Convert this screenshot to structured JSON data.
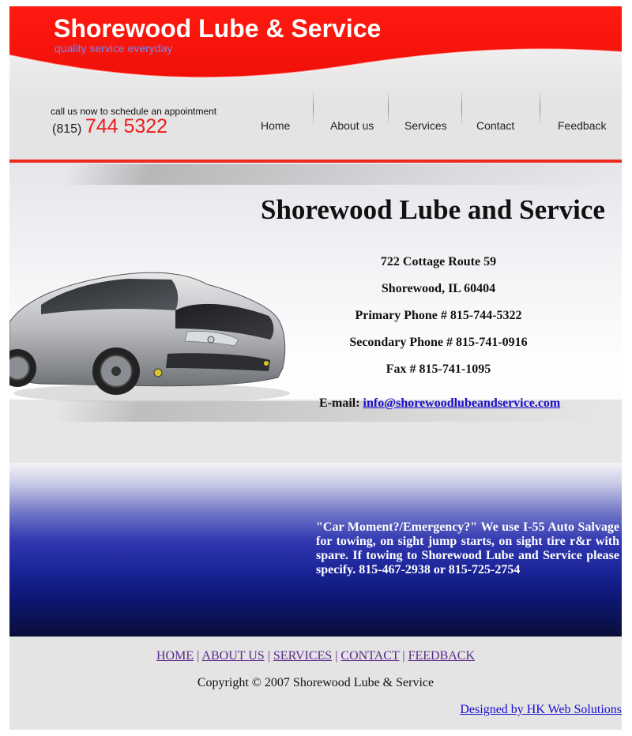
{
  "header": {
    "site_title": "Shorewood Lube & Service",
    "tagline": "quality service everyday",
    "call_label": "call us now to schedule an appointment",
    "phone_area": "(815)",
    "phone_number": "744 5322"
  },
  "nav": {
    "items": [
      "Home",
      "About us",
      "Services",
      "Contact",
      "Feedback"
    ]
  },
  "main": {
    "business_name": "Shorewood Lube and Service",
    "address_line1": "722 Cottage Route 59",
    "address_line2": "Shorewood, IL 60404",
    "primary_phone": "Primary Phone # 815-744-5322",
    "secondary_phone": "Secondary Phone # 815-741-0916",
    "fax": "Fax # 815-741-1095",
    "email_label": "E-mail:",
    "email": "info@shorewoodlubeandservice.com",
    "emergency_text": "\"Car Moment?/Emergency?\" We use I-55 Auto Salvage for towing, on sight jump starts, on sight tire r&r with spare. If towing to Shorewood Lube and Service please specify. 815-467-2938 or 815-725-2754"
  },
  "footer": {
    "links": [
      "HOME",
      "ABOUT US",
      "SERVICES",
      "CONTACT",
      "FEEDBACK"
    ],
    "separator": "|",
    "copyright": "Copyright © 2007 Shorewood Lube & Service",
    "designer": "Designed by HK Web Solutions"
  },
  "colors": {
    "brand_red": "#ee1b1b",
    "link_blue": "#1a0dcc",
    "visited_purple": "#5a2a8a",
    "band_blue": "#1a2498"
  },
  "icons": {
    "car_image": "car-image"
  }
}
